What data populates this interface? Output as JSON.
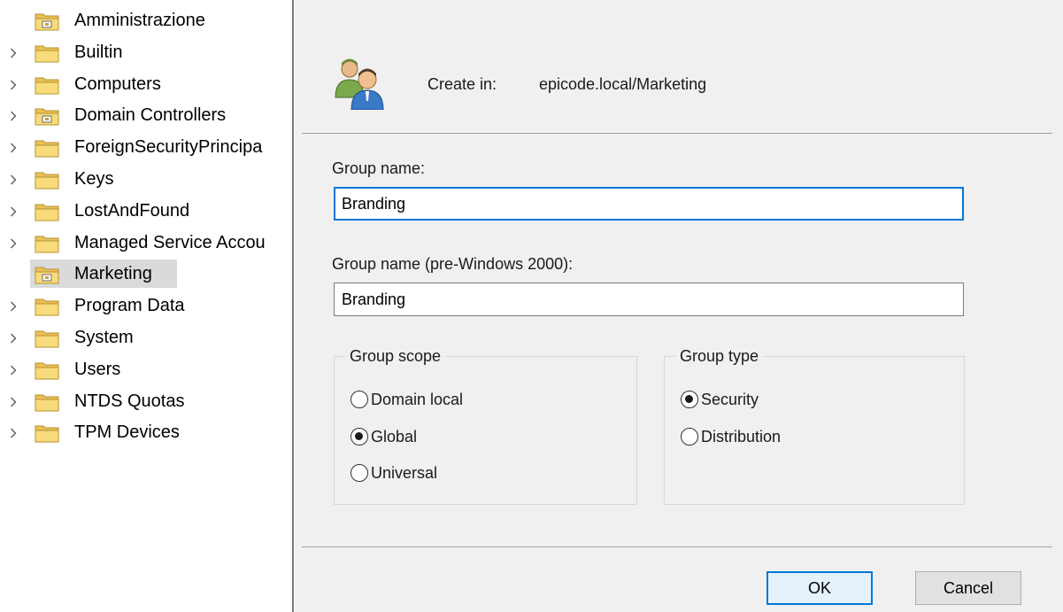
{
  "tree": {
    "items": [
      {
        "label": "Amministrazione",
        "expandable": false,
        "icon": "ou-folder-icon",
        "selected": false
      },
      {
        "label": "Builtin",
        "expandable": true,
        "icon": "folder-icon",
        "selected": false
      },
      {
        "label": "Computers",
        "expandable": true,
        "icon": "folder-icon",
        "selected": false
      },
      {
        "label": "Domain Controllers",
        "expandable": true,
        "icon": "ou-folder-icon",
        "selected": false
      },
      {
        "label": "ForeignSecurityPrincipa",
        "expandable": true,
        "icon": "folder-icon",
        "selected": false
      },
      {
        "label": "Keys",
        "expandable": true,
        "icon": "folder-icon",
        "selected": false
      },
      {
        "label": "LostAndFound",
        "expandable": true,
        "icon": "folder-icon",
        "selected": false
      },
      {
        "label": "Managed Service Accou",
        "expandable": true,
        "icon": "folder-icon",
        "selected": false
      },
      {
        "label": "Marketing",
        "expandable": false,
        "icon": "ou-folder-icon",
        "selected": true
      },
      {
        "label": "Program Data",
        "expandable": true,
        "icon": "folder-icon",
        "selected": false
      },
      {
        "label": "System",
        "expandable": true,
        "icon": "folder-icon",
        "selected": false
      },
      {
        "label": "Users",
        "expandable": true,
        "icon": "folder-icon",
        "selected": false
      },
      {
        "label": "NTDS Quotas",
        "expandable": true,
        "icon": "folder-icon",
        "selected": false
      },
      {
        "label": "TPM Devices",
        "expandable": true,
        "icon": "folder-icon",
        "selected": false
      }
    ]
  },
  "dialog": {
    "icon": "group-users-icon",
    "create_in_label": "Create in:",
    "create_in_path": "epicode.local/Marketing",
    "group_name_label": "Group name:",
    "group_name_value": "Branding",
    "group_name_pre2000_label": "Group name (pre-Windows 2000):",
    "group_name_pre2000_value": "Branding",
    "group_scope": {
      "title": "Group scope",
      "options": [
        "Domain local",
        "Global",
        "Universal"
      ],
      "selected": "Global"
    },
    "group_type": {
      "title": "Group type",
      "options": [
        "Security",
        "Distribution"
      ],
      "selected": "Security"
    },
    "ok_label": "OK",
    "cancel_label": "Cancel"
  },
  "colors": {
    "accent": "#0078d7",
    "dialog_bg": "#f0f0f0",
    "selection_bg": "#dadada",
    "folder_yellow": "#f5d66b"
  }
}
